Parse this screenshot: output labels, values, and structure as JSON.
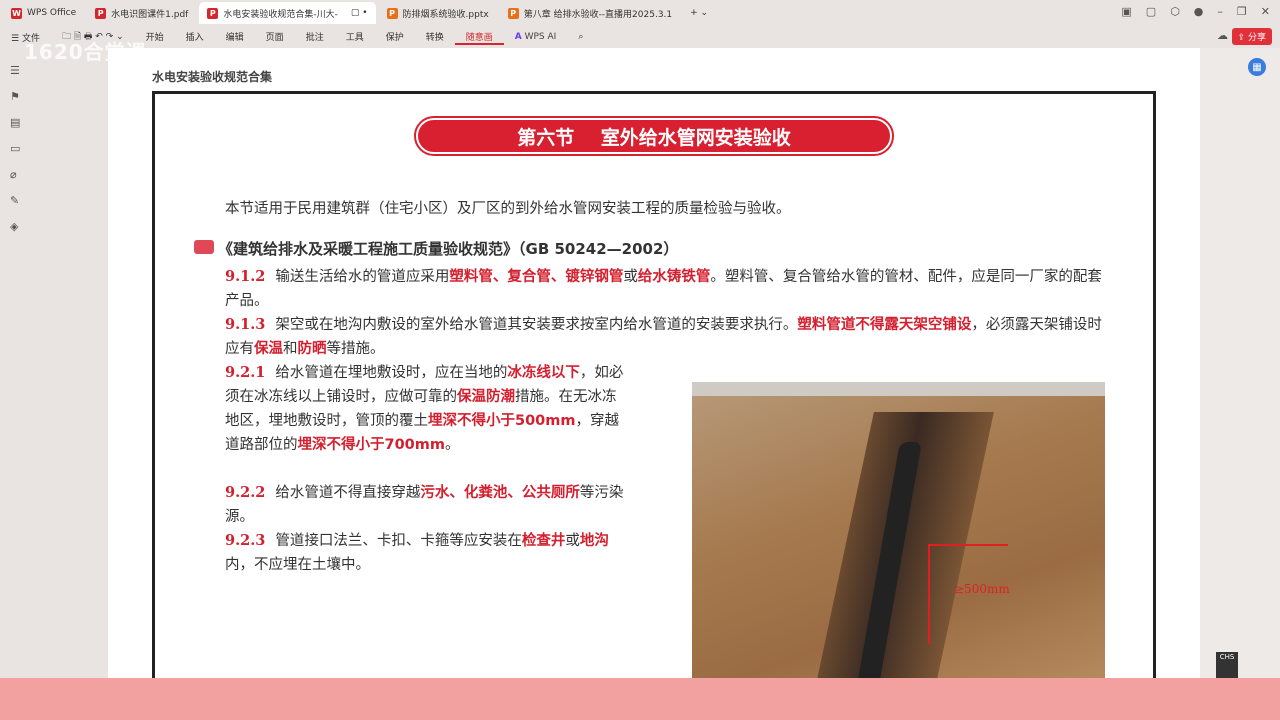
{
  "tabs": [
    {
      "label": "WPS Office",
      "color": "#d4262e",
      "icon": "W"
    },
    {
      "label": "水电识图课件1.pdf",
      "color": "#d4262e",
      "icon": "P"
    },
    {
      "label": "水电安装验收规范合集-川大-",
      "color": "#d4262e",
      "icon": "P",
      "active": true
    },
    {
      "label": "防排烟系统验收.pptx",
      "color": "#e8701a",
      "icon": "P"
    },
    {
      "label": "第八章 给排水验收--直播用2025.3.1",
      "color": "#e8701a",
      "icon": "P"
    }
  ],
  "toolbar": {
    "file": "文件",
    "items": [
      "开始",
      "插入",
      "编辑",
      "页面",
      "批注",
      "工具",
      "保护",
      "转换",
      "随意画"
    ],
    "ai": "WPS AI",
    "share": "分享"
  },
  "watermark": "1620合堂课",
  "doc": {
    "header": "水电安装验收规范合集",
    "banner": "第六节    室外给水管网安装验收",
    "intro": "本节适用于民用建筑群（住宅小区）及厂区的到外给水管网安装工程的质量检验与验收。",
    "standard": "《建筑给排水及采暖工程施工质量验收规范》（GB 50242—2002）",
    "paras": [
      {
        "num": "9.1.2",
        "segs": [
          [
            "输送生活给水的管道应采用",
            0
          ],
          [
            "塑料管、复合管、镀锌钢管",
            1
          ],
          [
            "或",
            0
          ],
          [
            "给水铸铁管",
            1
          ],
          [
            "。塑料管、复合管给水管的管材、配件，应是同一厂家的配套产品。",
            0
          ]
        ]
      },
      {
        "num": "9.1.3",
        "segs": [
          [
            "架空或在地沟内敷设的室外给水管道其安装要求按室内给水管道的安装要求执行。",
            0
          ],
          [
            "塑料管道不得露天架空铺设",
            1
          ],
          [
            "，必须露天架铺设时应有",
            0
          ],
          [
            "保温",
            1
          ],
          [
            "和",
            0
          ],
          [
            "防晒",
            1
          ],
          [
            "等措施。",
            0
          ]
        ]
      },
      {
        "num": "9.2.1",
        "segs": [
          [
            "给水管道在埋地敷设时，应在当地的",
            0
          ],
          [
            "冰冻线以下",
            1
          ],
          [
            "，如必须在冰冻线以上铺设时，应做可靠的",
            0
          ],
          [
            "保温防潮",
            1
          ],
          [
            "措施。在无冰冻地区，埋地敷设时，管顶的覆土",
            0
          ],
          [
            "埋深不得小于500mm",
            1
          ],
          [
            "，穿越道路部位的",
            0
          ],
          [
            "埋深不得小于700mm",
            1
          ],
          [
            "。",
            0
          ]
        ]
      },
      {
        "num": "9.2.2",
        "segs": [
          [
            "给水管道不得直接穿越",
            0
          ],
          [
            "污水、化粪池、公共厕所",
            1
          ],
          [
            "等污染源。",
            0
          ]
        ]
      },
      {
        "num": "9.2.3",
        "segs": [
          [
            "管道接口法兰、卡扣、卡箍等应安装在",
            0
          ],
          [
            "检查井",
            1
          ],
          [
            "或",
            0
          ],
          [
            "地沟",
            1
          ],
          [
            "内，不应埋在土壤中。",
            0
          ]
        ]
      }
    ],
    "photo_label": "≥500mm"
  },
  "ime": "CHS"
}
